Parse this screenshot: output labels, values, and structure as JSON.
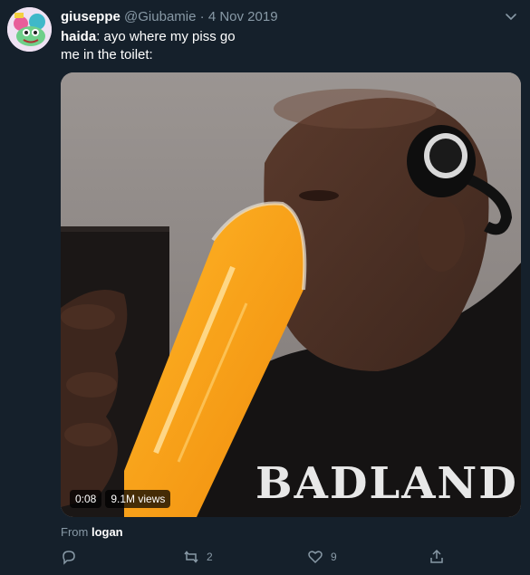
{
  "user": {
    "display_name": "giuseppe",
    "handle": "@Giubamie",
    "separator": "·",
    "date": "4 Nov 2019"
  },
  "tweet": {
    "line1_name": "haida",
    "line1_rest": ": ayo where my piss go",
    "line2": "me in the toilet:"
  },
  "media": {
    "duration": "0:08",
    "views": "9.1M views",
    "shirt_text": "BADLAND"
  },
  "source": {
    "prefix": "From ",
    "name": "logan"
  },
  "actions": {
    "reply_count": "",
    "retweet_count": "2",
    "like_count": "9"
  },
  "colors": {
    "background": "#15202b",
    "secondary_text": "#8899a6",
    "juice": "#f7a21a"
  },
  "icons": [
    "avatar-image",
    "chevron-down-icon",
    "reply-icon",
    "retweet-icon",
    "like-icon",
    "share-icon"
  ]
}
